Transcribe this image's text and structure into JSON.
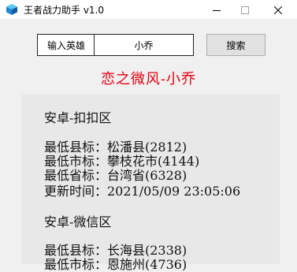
{
  "window": {
    "title": "王者战力助手 v1.0"
  },
  "search": {
    "label": "输入英雄",
    "value": "小乔",
    "button_label": "搜索"
  },
  "author": "恋之微风-小乔",
  "results": {
    "android_qq": {
      "header": "安卓-扣扣区",
      "county": "最低县标：松潘县(2812)",
      "city": "最低市标：攀枝花市(4144)",
      "province": "最低省标：台湾省(6328)",
      "updated": "更新时间：2021/05/09 23:05:06"
    },
    "android_wechat": {
      "header": "安卓-微信区",
      "county": "最低县标：长海县(2338)",
      "city": "最低市标：恩施州(4736)"
    }
  },
  "colors": {
    "author": "#e60012",
    "panel": "#e8e8e8",
    "window_bg": "#f0f0f0"
  },
  "icons": {
    "app": "cube-icon",
    "minimize": "minimize-icon",
    "maximize": "maximize-icon",
    "close": "close-icon"
  }
}
